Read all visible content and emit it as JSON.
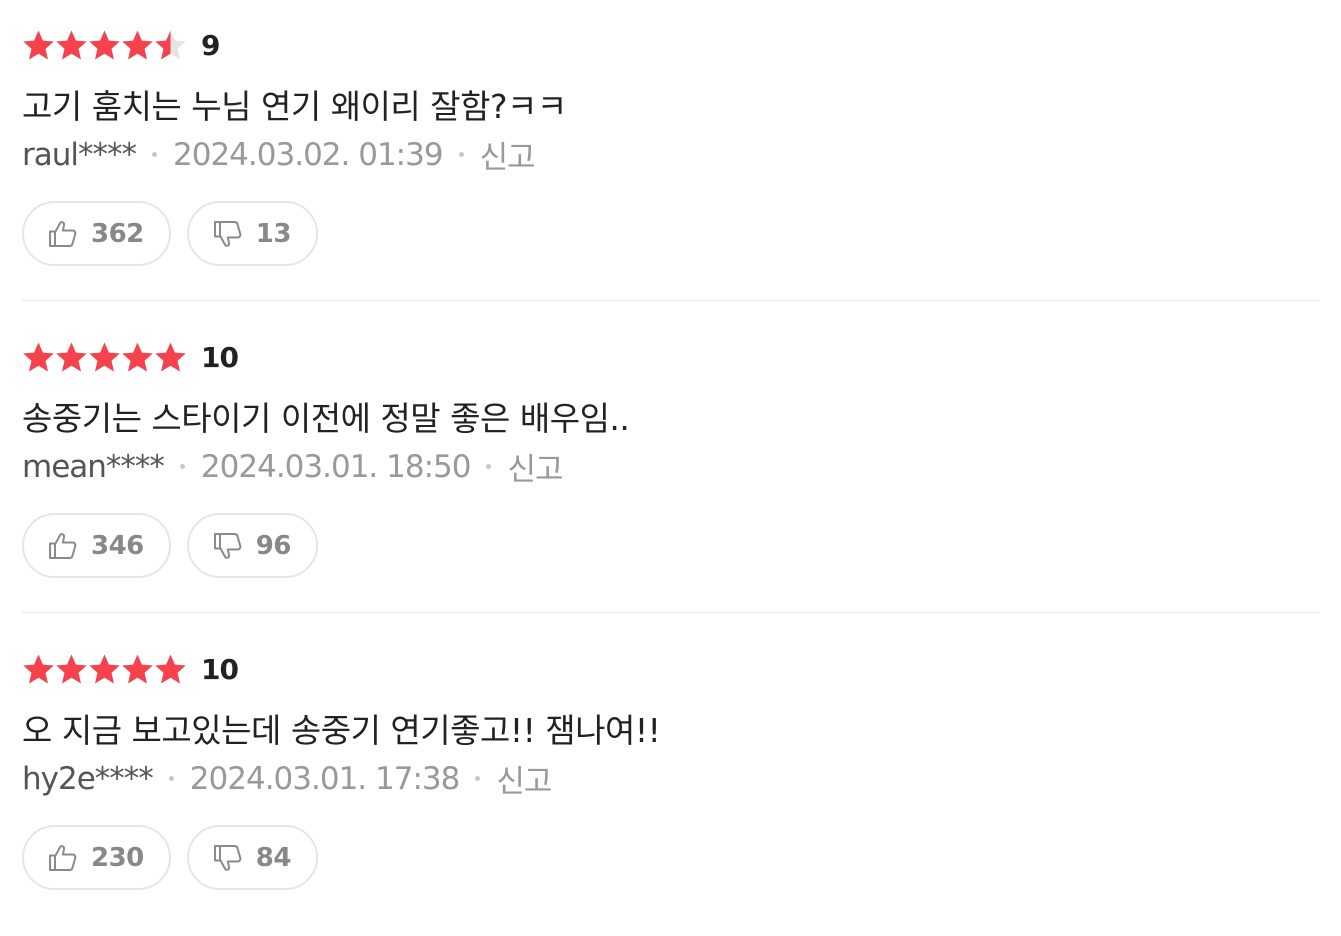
{
  "colors": {
    "star_filled": "#f5424d",
    "star_empty": "#e4e4e4",
    "text_primary": "#222222",
    "text_secondary": "#999999"
  },
  "reviews": [
    {
      "score": "9",
      "star_fill": 4.5,
      "comment": "고기 훔치는 누님 연기 왜이리 잘함?ㅋㅋ",
      "user": "raul****",
      "date": "2024.03.02. 01:39",
      "report": "신고",
      "likes": "362",
      "dislikes": "13"
    },
    {
      "score": "10",
      "star_fill": 5,
      "comment": "송중기는 스타이기 이전에 정말 좋은 배우임..",
      "user": "mean****",
      "date": "2024.03.01. 18:50",
      "report": "신고",
      "likes": "346",
      "dislikes": "96"
    },
    {
      "score": "10",
      "star_fill": 5,
      "comment": "오 지금 보고있는데 송중기 연기좋고!! 잼나여!!",
      "user": "hy2e****",
      "date": "2024.03.01. 17:38",
      "report": "신고",
      "likes": "230",
      "dislikes": "84"
    }
  ]
}
